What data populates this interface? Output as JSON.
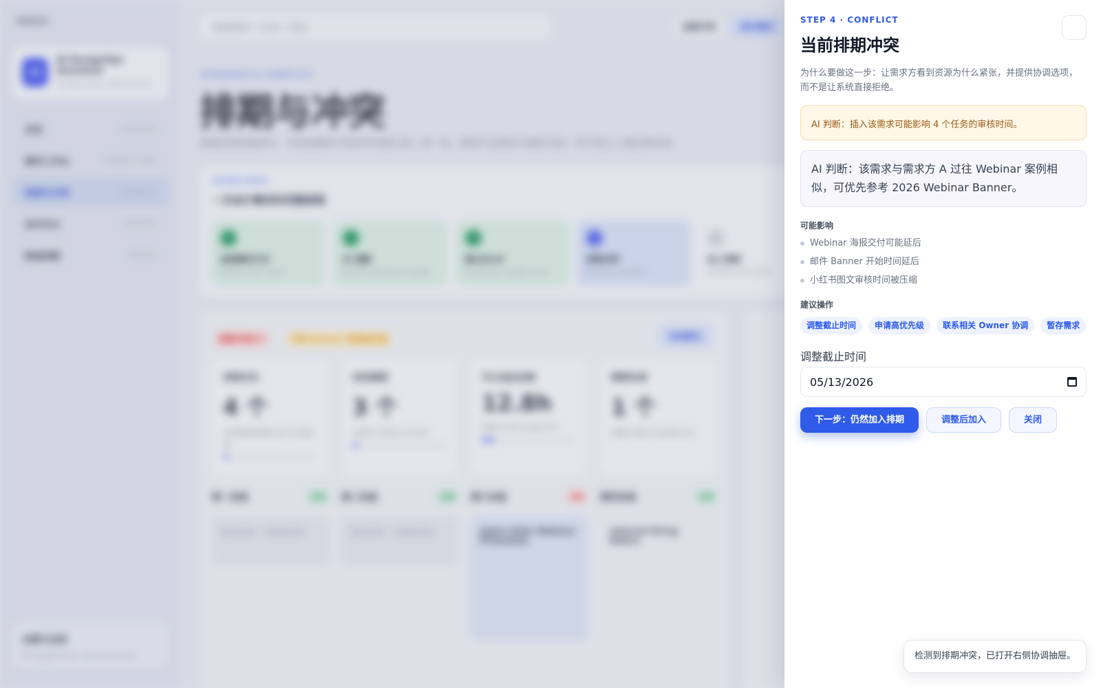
{
  "background": {
    "sidebar": {
      "brand_mini": "RDESO",
      "app_card": {
        "logo": "AI",
        "name": "AI DesignOps Assistant",
        "sub": "Collaboration Workbench"
      },
      "nav": [
        {
          "label": "总览",
          "meta": "Dashboard"
        },
        {
          "label": "需求工作台",
          "meta": "REQUEST DESK"
        },
        {
          "label": "排期与冲突",
          "meta": "SCHEDULE",
          "active": true
        },
        {
          "label": "协作交付",
          "meta": "DELIVERY"
        },
        {
          "label": "数据洞察",
          "meta": "INSIGHT"
        }
      ],
      "footer": {
        "title": "设置与治理",
        "sub": "AI suggestions, human decide"
      }
    },
    "header": {
      "search_placeholder": "搜索需求 / 任务 / 项目",
      "btn_secondary": "查看冲突",
      "btn_primary": "提交需求"
    },
    "page": {
      "eyebrow": "SCHEDULE & CONFLICT",
      "title": "排期与冲突",
      "desc": "根据资源容量排队、识别依赖和冲突的时间窗口统一成一处，帮助产品提前沟通优先级，而不是让人事后再协商。"
    },
    "steps": {
      "eyebrow": "GUIDED DEMO",
      "title": "一次设计需求的完整旅程",
      "items": [
        {
          "name": "选择需求方式",
          "desc": "Define your work"
        },
        {
          "name": "AI 理解",
          "desc": "Brief analyzed & ready"
        },
        {
          "name": "确认Brief",
          "desc": "Summary ready to go"
        },
        {
          "name": "排期冲突",
          "desc": "Resolve conflict"
        },
        {
          "name": "加入排期",
          "desc": "Confirm to board"
        }
      ]
    },
    "board": {
      "pills": [
        "排期冲突3个",
        "可能 Banner 排期被压缩"
      ],
      "action": "协调建议",
      "kpis": [
        {
          "k": "排期任务",
          "v": "4 个",
          "d": "本周需要排期的设计任务数量"
        },
        {
          "k": "协助需要",
          "v": "3 个",
          "d": "设置为不同的工作负载"
        },
        {
          "k": "可以追加总额",
          "v": "12.8h",
          "d": "按照计划可以追加工时"
        },
        {
          "k": "需要协调",
          "v": "1 个",
          "d": "需要与需求方协调的任务"
        }
      ],
      "columns": [
        {
          "title": "第一泳道",
          "tag": "正常",
          "empty": "暂无任务，可继续安排"
        },
        {
          "title": "第二泳道",
          "tag": "正常",
          "empty": "暂无任务，可继续安排"
        },
        {
          "title": "第三泳道",
          "tag": "冲突",
          "task": "Japan Sales Webinar Promotion"
        },
        {
          "title": "第四泳道",
          "tag": "正常",
          "task": "Internal Hiring Notice"
        }
      ]
    }
  },
  "drawer": {
    "eyebrow": "STEP 4 · CONFLICT",
    "title": "当前排期冲突",
    "intro": "为什么要做这一步：让需求方看到资源为什么紧张，并提供协调选项，而不是让系统直接拒绝。",
    "warning": "AI 判断：插入该需求可能影响 4 个任务的审核时间。",
    "ai_suggestion": "AI 判断：该需求与需求方 A 过往 Webinar 案例相似，可优先参考 2026 Webinar Banner。",
    "impact_title": "可能影响",
    "impacts": [
      "Webinar 海报交付可能延后",
      "邮件 Banner 开始时间延后",
      "小红书图文审核时间被压缩"
    ],
    "actions_title": "建议操作",
    "actions": [
      "调整截止时间",
      "申请高优先级",
      "联系相关 Owner 协调",
      "暂存需求"
    ],
    "deadline_label": "调整截止时间",
    "deadline_value": "05/13/2026",
    "btn_primary": "下一步：仍然加入排期",
    "btn_adjust": "调整后加入",
    "btn_close": "关闭"
  },
  "toast": "检测到排期冲突，已打开右侧协调抽屉。",
  "colors": {
    "accent": "#2f5be8",
    "warning_bg": "#fff7e8",
    "warning_text": "#9a5b13"
  }
}
